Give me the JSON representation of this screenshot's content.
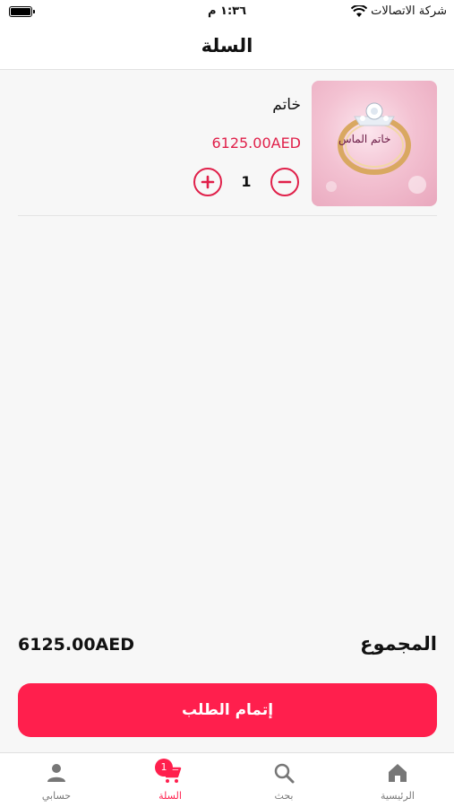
{
  "status_bar": {
    "carrier": "شركة الاتصالات",
    "time": "١:٣٦ م"
  },
  "header": {
    "title": "السلة"
  },
  "cart": {
    "items": [
      {
        "name": "خاتم",
        "price": "6125.00AED",
        "quantity": "1",
        "image_label": "خاتم الماس"
      }
    ]
  },
  "summary": {
    "total_label": "المجموع",
    "total_value": "6125.00AED"
  },
  "checkout": {
    "label": "إتمام الطلب"
  },
  "tabs": [
    {
      "label": "الرئيسية",
      "icon": "home-icon"
    },
    {
      "label": "بحث",
      "icon": "search-icon"
    },
    {
      "label": "السلة",
      "icon": "cart-icon",
      "badge": "1",
      "active": true
    },
    {
      "label": "حسابي",
      "icon": "person-icon"
    }
  ],
  "colors": {
    "accent": "#ff1f4d",
    "price": "#e0204a",
    "inactive_tab": "#777777"
  }
}
